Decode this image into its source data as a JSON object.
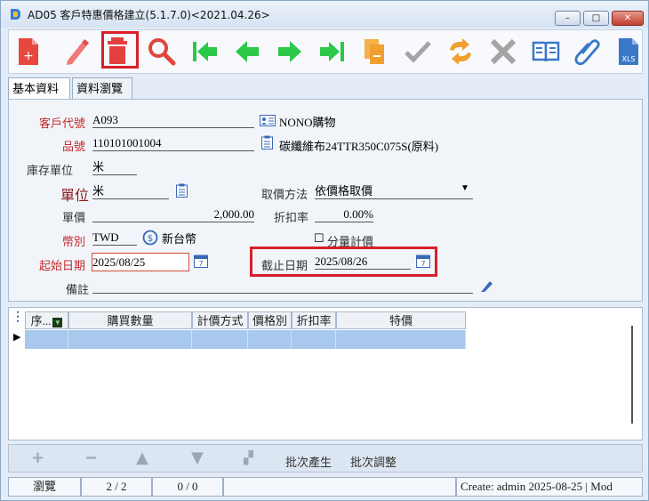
{
  "window": {
    "title": "AD05 客戶特惠價格建立(5.1.7.0)<2021.04.26>",
    "min": "–",
    "max": "□",
    "close": "✕"
  },
  "toolbar": {
    "buttons": [
      {
        "name": "new-icon",
        "color": "#e53d3d"
      },
      {
        "name": "edit-icon",
        "color": "#f07070"
      },
      {
        "name": "delete-icon",
        "color": "#e53d3d"
      },
      {
        "name": "search-icon",
        "color": "#e0453a"
      },
      {
        "name": "first-record-icon",
        "color": "#2cc84a"
      },
      {
        "name": "prev-record-icon",
        "color": "#2cc84a"
      },
      {
        "name": "next-record-icon",
        "color": "#2cc84a"
      },
      {
        "name": "last-record-icon",
        "color": "#2cc84a"
      },
      {
        "name": "copy-icon",
        "color": "#f0a030"
      },
      {
        "name": "confirm-icon",
        "color": "#a0a0a0"
      },
      {
        "name": "refresh-icon",
        "color": "#f0a030"
      },
      {
        "name": "cancel-icon",
        "color": "#a0a0a0"
      },
      {
        "name": "book-icon",
        "color": "#3a78c8"
      },
      {
        "name": "attachment-icon",
        "color": "#3a78c8"
      },
      {
        "name": "excel-export-icon",
        "color": "#3a78c8"
      }
    ]
  },
  "tabs": [
    {
      "label": "基本資料"
    },
    {
      "label": "資料瀏覽"
    }
  ],
  "form": {
    "customer_code_label": "客戶代號",
    "customer_code": "A093",
    "customer_name": "NONO購物",
    "item_no_label": "品號",
    "item_no": "110101001004",
    "item_name": "碳纖維布24TTR350C075S(原料)",
    "stock_unit_label": "庫存單位",
    "stock_unit": "米",
    "unit_label": "單位",
    "unit": "米",
    "pricing_method_label": "取價方法",
    "pricing_method": "依價格取價",
    "unit_price_label": "單價",
    "unit_price": "2,000.00",
    "discount_label": "折扣率",
    "discount": "0.00%",
    "currency_label": "幣別",
    "currency": "TWD",
    "currency_name": "新台幣",
    "qty_pricing_label": "分量計價",
    "start_date_label": "起始日期",
    "start_date": "2025/08/25",
    "end_date_label": "截止日期",
    "end_date": "2025/08/26",
    "remark_label": "備註",
    "remark": ""
  },
  "grid": {
    "columns": [
      "序...",
      "購買數量",
      "計價方式",
      "價格別",
      "折扣率",
      "特價"
    ]
  },
  "bottom": {
    "batch_generate": "批次產生",
    "batch_adjust": "批次調整"
  },
  "status": {
    "mode": "瀏覽",
    "record": "2 / 2",
    "count": "0 / 0",
    "info": "Create: admin 2025-08-25 | Mod"
  }
}
